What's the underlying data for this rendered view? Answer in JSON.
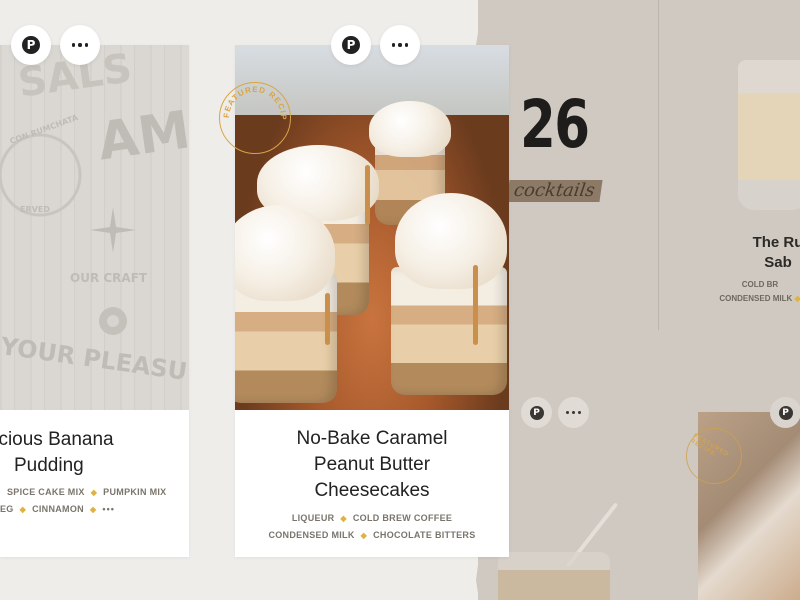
{
  "cards": {
    "left": {
      "title_lines": [
        "licious Banana",
        "Pudding"
      ],
      "tags_line1": [
        "SPICE CAKE MIX",
        "PUMPKIN MIX"
      ],
      "tags_line2": [
        "EG",
        "CINNAMON"
      ],
      "more": "•••",
      "image_words": {
        "w1": "SALS",
        "w2": "AMI",
        "w3": "OUR  CRAFT",
        "w4": "YOUR PLEASU",
        "w5": "CON RUMCHATA",
        "w6": "ERVED"
      }
    },
    "center": {
      "title_lines": [
        "No-Bake Caramel",
        "Peanut Butter",
        "Cheesecakes"
      ],
      "tags_line1": [
        "LIQUEUR",
        "COLD BREW COFFEE"
      ],
      "tags_line2": [
        "CONDENSED MILK",
        "CHOCOLATE BITTERS"
      ],
      "badge": "FEATURED RECIPE"
    },
    "right": {
      "title_lines": [
        "The Ru",
        "Sab"
      ],
      "tags_line1": [
        "COLD BR"
      ],
      "tags_line2": [
        "CONDENSED MILK"
      ],
      "badge": "FEATURED RECIPE"
    }
  },
  "promo": {
    "number": "26",
    "script": "cocktails"
  },
  "icons": {
    "pin_glyph": "P",
    "dot_glyph": "◆"
  },
  "colors": {
    "accent_gold": "#e0b341",
    "background": "#efedea"
  }
}
